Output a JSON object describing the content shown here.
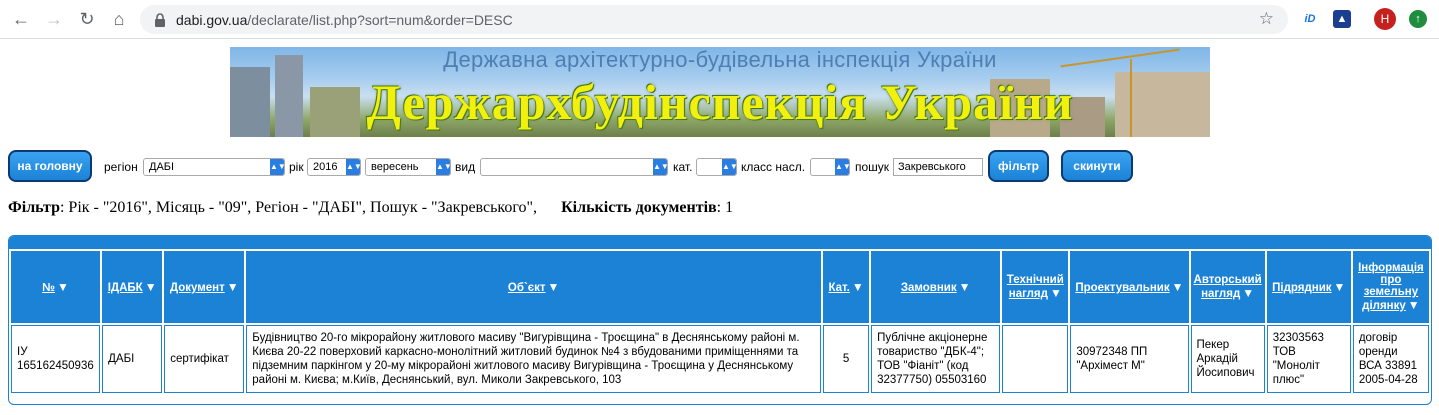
{
  "browser": {
    "url_host": "dabi.gov.ua",
    "url_path": "/declarate/list.php?sort=num&order=DESC",
    "profile_initial": "H",
    "ext_label": "iD"
  },
  "banner": {
    "subtitle": "Державна архітектурно-будівельна інспекція України",
    "title": "Держархбудінспекція України"
  },
  "filter_bar": {
    "home_label": "на головну",
    "region_label": "регіон",
    "region_value": "ДАБІ",
    "year_label": "рік",
    "year_value": "2016",
    "month_value": "вересень",
    "type_label": "вид",
    "type_value": "",
    "category_label": "кат.",
    "category_value": "",
    "class_label": "класс насл.",
    "class_value": "",
    "search_label": "пошук",
    "search_value": "Закревського",
    "filter_button": "фільтр",
    "reset_button": "скинути"
  },
  "summary": {
    "filter_label": "Фільтр",
    "filter_text": ": Рік - \"2016\", Місяць - \"09\", Регіон - \"ДАБІ\", Пошук - \"Закревського\",",
    "count_label": "Кількість документів",
    "count_value": ": 1"
  },
  "table": {
    "headers": [
      {
        "label": "№",
        "sortable": true
      },
      {
        "label": "ІДАБК",
        "sortable": true
      },
      {
        "label": "Документ",
        "sortable": true
      },
      {
        "label": "Об`єкт",
        "sortable": true
      },
      {
        "label": "Кат.",
        "sortable": true
      },
      {
        "label": "Замовник",
        "sortable": true
      },
      {
        "label": "Технічний нагляд",
        "sortable": true
      },
      {
        "label": "Проектувальник",
        "sortable": true
      },
      {
        "label": "Авторський нагляд",
        "sortable": true
      },
      {
        "label": "Підрядник",
        "sortable": true
      },
      {
        "label": "Інформація про земельну ділянку",
        "sortable": true
      }
    ],
    "rows": [
      {
        "num": "ІУ 165162450936",
        "idabk": "ДАБІ",
        "document": "сертифікат",
        "object": "Будівництво 20-го мікрорайону житлового масиву \"Вигурівщина - Троєщина\" в Деснянському районі м. Києва 20-22 поверховий каркасно-монолітний житловий будинок №4 з вбудованими приміщеннями та підземним паркінгом у 20-му мікрорайоні житлового масиву Вигурівщина - Троєщина у Деснянському районі м. Києва; м.Київ, Деснянський, вул. Миколи Закревського, 103",
        "category": "5",
        "customer": "Публічне акціонерне товариство \"ДБК-4\"; ТОВ \"Фіаніт\" (код 32377750) 05503160",
        "tech_supervision": "",
        "designer": "30972348 ПП \"Архімест М\"",
        "author_supervision": "Пекер Аркадій Йосипович",
        "contractor": "32303563 ТОВ \"Моноліт плюс\"",
        "land_info": "договір оренди ВСА 33891 2005-04-28"
      }
    ]
  },
  "colors": {
    "table_blue": "#1b82d6",
    "button_border": "#0b3a73",
    "banner_title": "#f2f10e"
  }
}
